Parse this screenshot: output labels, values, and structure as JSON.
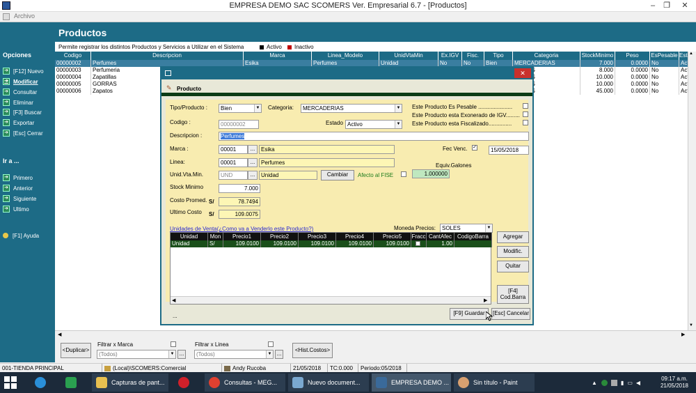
{
  "window": {
    "title": "EMPRESA DEMO SAC        SCOMERS Ver. Empresarial  6.7 - [Productos]"
  },
  "menu": {
    "archivo": "Archivo"
  },
  "header": {
    "title": "Productos"
  },
  "legend": {
    "text": "Permite registrar los distintos Productos y Servicios a Utilizar en el Sistema",
    "activo": "Activo",
    "inactivo": "Inactivo"
  },
  "colors": {
    "activo": "#000000",
    "inactivo": "#c00000",
    "accent": "#1d6b86"
  },
  "sidebar": {
    "opciones": "Opciones",
    "items": [
      "[F12] Nuevo",
      "Modificar",
      "Consultar",
      "Eliminar",
      "[F3] Buscar",
      "Exportar",
      "[Esc] Cerrar"
    ],
    "ira": "Ir a ...",
    "nav": [
      "Primero",
      "Anterior",
      "Siguiente",
      "Ultimo"
    ],
    "help": "[F1] Ayuda"
  },
  "grid": {
    "headers": [
      "Codigo",
      "Descripcion",
      "Marca",
      "Linea_Modelo",
      "UnidVtaMin",
      "Ex.IGV",
      "Fisc.",
      "Tipo",
      "Categoria",
      "StockMinimo",
      "Peso",
      "EsPesable",
      "Estado"
    ],
    "rows": [
      [
        "00000002",
        "Perfumes",
        "Esika",
        "Perfumes",
        "Unidad",
        "No",
        "No",
        "Bien",
        "MERCADERIAS",
        "7.000",
        "0.0000",
        "No",
        "Activo"
      ],
      [
        "00000003",
        "Perfumeria",
        "",
        "",
        "",
        "",
        "",
        "",
        "DERIAS",
        "8.000",
        "0.0000",
        "No",
        "Activo"
      ],
      [
        "00000004",
        "Zapatillas",
        "",
        "",
        "",
        "",
        "",
        "",
        "DERIAS",
        "10.000",
        "0.0000",
        "No",
        "Activo"
      ],
      [
        "00000005",
        "GORRAS",
        "",
        "",
        "",
        "",
        "",
        "",
        "DERIAS",
        "10.000",
        "0.0000",
        "No",
        "Activo"
      ],
      [
        "00000006",
        "Zapatos",
        "",
        "",
        "",
        "",
        "",
        "",
        "DERIAS",
        "45.000",
        "0.0000",
        "No",
        "Activo"
      ]
    ]
  },
  "bottom": {
    "duplicar": "<Duplicar>",
    "filtro_marca": "Filtrar x Marca",
    "filtro_linea": "Filtrar x Linea",
    "todos": "(Todos)",
    "hist": "<Hist.Costos>"
  },
  "status": {
    "tienda": "001-TIENDA PRINCIPAL",
    "db": "(Local)\\SCOMERS:Comercial",
    "user": "Andy Rucoba",
    "fecha": "21/05/2018",
    "tc": "TC:0.000",
    "periodo": "Periodo:05/2018"
  },
  "dialog": {
    "title": "Producto",
    "tipo_label": "Tipo/Producto :",
    "tipo_value": "Bien",
    "categoria_label": "Categoria:",
    "categoria_value": "MERCADERIAS",
    "pesable": "Este Producto Es Pesable ......................",
    "exonerado": "Este Producto esta Exonerado de IGV.........",
    "fiscalizado": "Este Producto esta Fiscalizado...............",
    "codigo_label": "Codigo :",
    "codigo_value": "00000002",
    "estado_label": "Estado",
    "estado_value": "Activo",
    "descripcion_label": "Descripcion :",
    "descripcion_value": "Perfumes",
    "marca_label": "Marca :",
    "marca_code": "00001",
    "marca_name": "Esika",
    "fecvenc_label": "Fec Venc.",
    "fecvenc_value": "15/05/2018",
    "linea_label": "Linea:",
    "linea_code": "00001",
    "linea_name": "Perfumes",
    "equiv_label": "Equiv.Galones",
    "equiv_value": "1.000000",
    "unid_label": "Unid.Vta.Min.",
    "unid_code": "UND",
    "unid_name": "Unidad",
    "cambiar": "Cambiar",
    "fise_label": "Afecto al FISE",
    "stock_label": "Stock Minimo",
    "stock_value": "7.000",
    "costo_label": "Costo Promed.",
    "costo_value": "78.7494",
    "ultimo_label": "Ultimo Costo",
    "ultimo_value": "109.0075",
    "currency": "S/",
    "unidades_link": "Unidades de Venta(¿Como va a Venderlo este Producto?)",
    "moneda_label": "Moneda Precios:",
    "moneda_value": "SOLES",
    "ugrid_headers": [
      "Unidad",
      "Mon",
      "Precio1",
      "Precio2",
      "Precio3",
      "Precio4",
      "Precio5",
      "Fracc",
      "CantAfec",
      "CodigoBarra"
    ],
    "ugrid_row": [
      "Unidad",
      "S/",
      "109.0100",
      "109.0100",
      "109.0100",
      "109.0100",
      "109.0100",
      "",
      "1.00",
      ""
    ],
    "agregar": "Agregar",
    "modific": "Modific.",
    "quitar": "Quitar",
    "codbarra": "[F4]\nCod.Barra",
    "ellipsis": "...",
    "guardar": "[F9] Guardar",
    "cancelar": "[Esc] Cancelar"
  },
  "taskbar": {
    "items": [
      "Capturas de pant...",
      "Consultas - MEG...",
      "Nuevo document...",
      "EMPRESA DEMO ...",
      "Sin título - Paint"
    ],
    "time": "09:17 a.m.",
    "date": "21/05/2018"
  }
}
